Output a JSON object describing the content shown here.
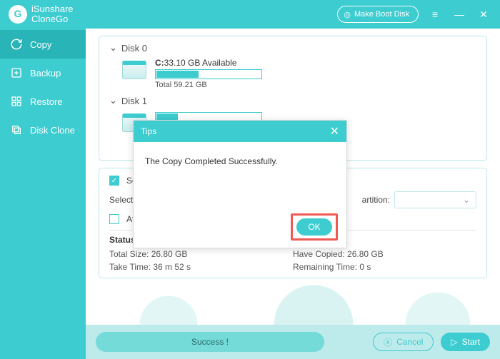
{
  "titlebar": {
    "logo_line1": "iSunshare",
    "logo_line2": "CloneGo",
    "boot_label": "Make Boot Disk"
  },
  "sidebar": {
    "items": [
      {
        "label": "Copy"
      },
      {
        "label": "Backup"
      },
      {
        "label": "Restore"
      },
      {
        "label": "Disk Clone"
      }
    ]
  },
  "disks": {
    "d0": {
      "head": "Disk 0",
      "drive": "C:",
      "avail": "33.10 GB Available",
      "total": "Total 59.21 GB"
    },
    "d1": {
      "head": "Disk 1"
    }
  },
  "options": {
    "set_label": "Set t",
    "select_label": "Select a",
    "after_label": "After",
    "partition_label": "artition:"
  },
  "status": {
    "head": "Status:",
    "total_label": "Total Size: 26.80 GB",
    "copied": "Have Copied: 26.80 GB",
    "time": "Take Time: 36 m 52 s",
    "remain": "Remaining Time: 0 s"
  },
  "footer": {
    "success": "Success !",
    "cancel": "Cancel",
    "start": "Start"
  },
  "modal": {
    "title": "Tips",
    "msg": "The Copy Completed Successfully.",
    "ok": "OK"
  }
}
